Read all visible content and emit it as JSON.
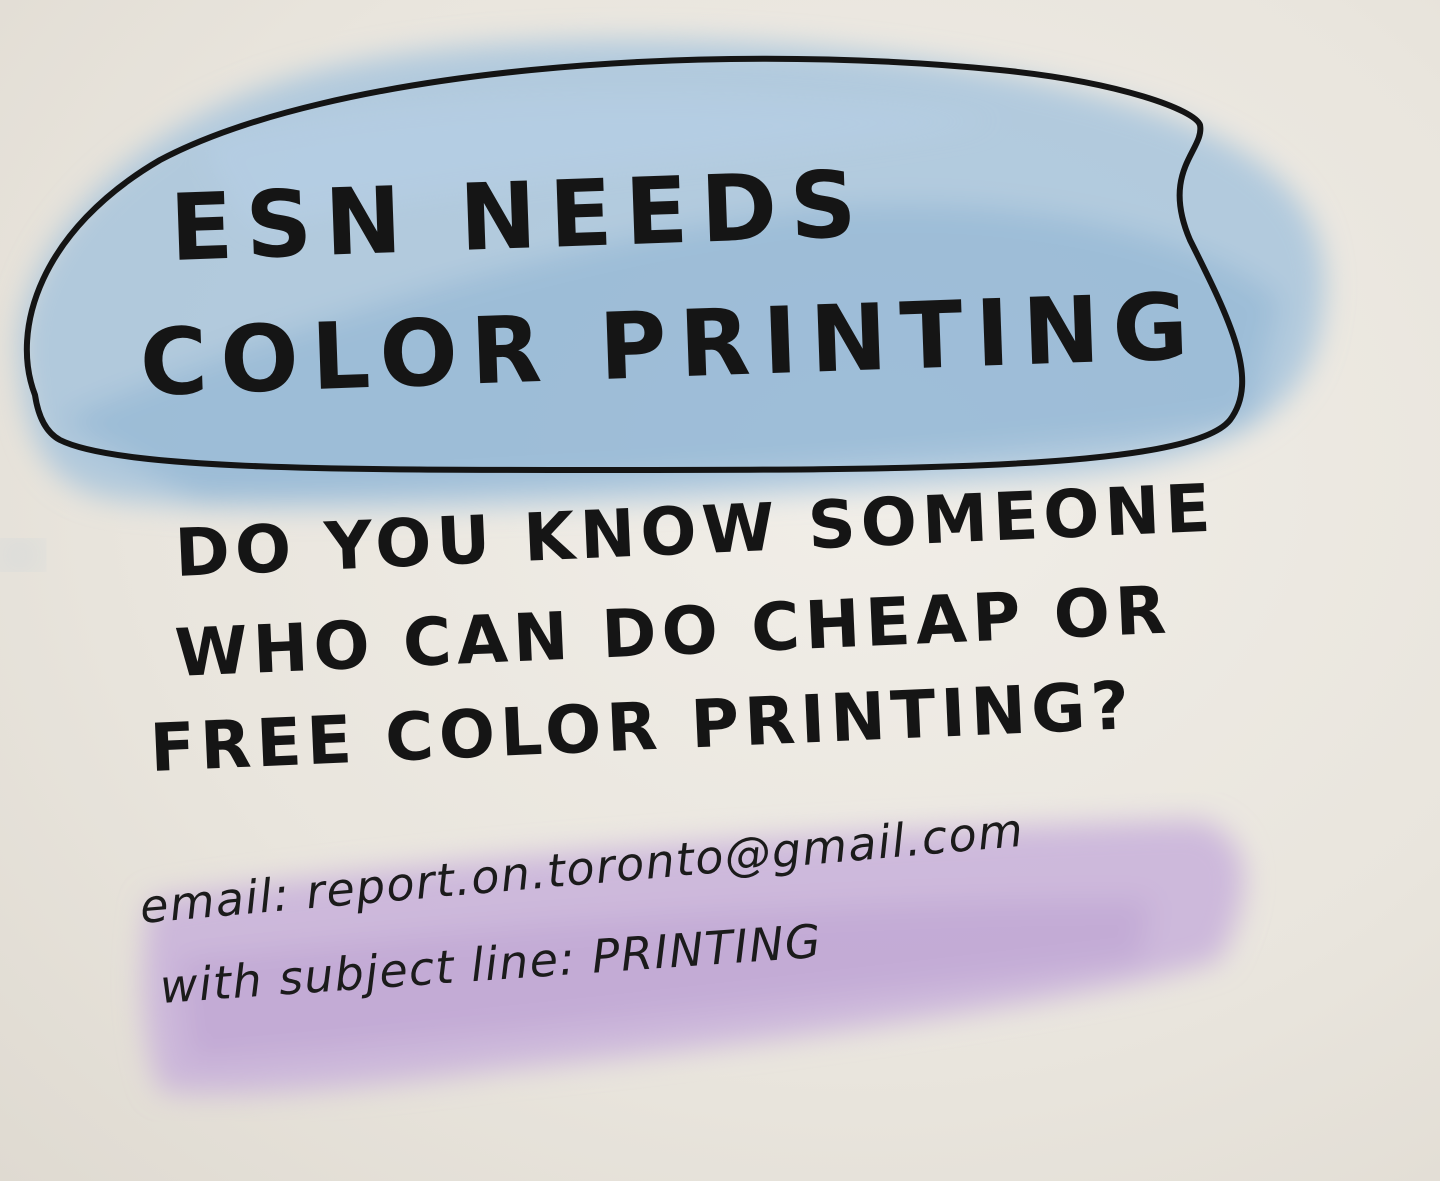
{
  "headline": {
    "line1": "ESN NEEDS",
    "line2": "COLOR PRINTING"
  },
  "question": {
    "line1": "DO YOU KNOW SOMEONE",
    "line2": "WHO CAN DO CHEAP OR",
    "line3": "FREE COLOR PRINTING?"
  },
  "contact": {
    "line1": "email: report.on.toronto@gmail.com",
    "line2": "with subject line: PRINTING"
  },
  "colors": {
    "paper": "#ece8e0",
    "blue_wash": "#9fc0dc",
    "purple_wash": "#c8b0da",
    "ink": "#151515"
  }
}
